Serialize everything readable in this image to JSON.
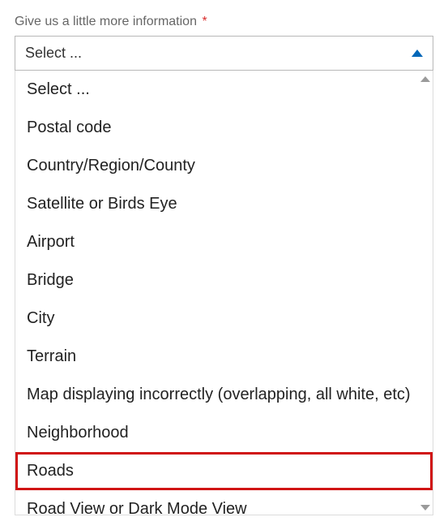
{
  "field": {
    "label": "Give us a little more information",
    "required_marker": "*",
    "selected_value": "Select ..."
  },
  "dropdown": {
    "options": [
      {
        "label": "Select ...",
        "highlighted": false
      },
      {
        "label": "Postal code",
        "highlighted": false
      },
      {
        "label": "Country/Region/County",
        "highlighted": false
      },
      {
        "label": "Satellite or Birds Eye",
        "highlighted": false
      },
      {
        "label": "Airport",
        "highlighted": false
      },
      {
        "label": "Bridge",
        "highlighted": false
      },
      {
        "label": "City",
        "highlighted": false
      },
      {
        "label": "Terrain",
        "highlighted": false
      },
      {
        "label": "Map displaying incorrectly (overlapping, all white, etc)",
        "highlighted": false
      },
      {
        "label": "Neighborhood",
        "highlighted": false
      },
      {
        "label": "Roads",
        "highlighted": true
      },
      {
        "label": "Road View or Dark Mode View",
        "highlighted": false
      }
    ]
  }
}
